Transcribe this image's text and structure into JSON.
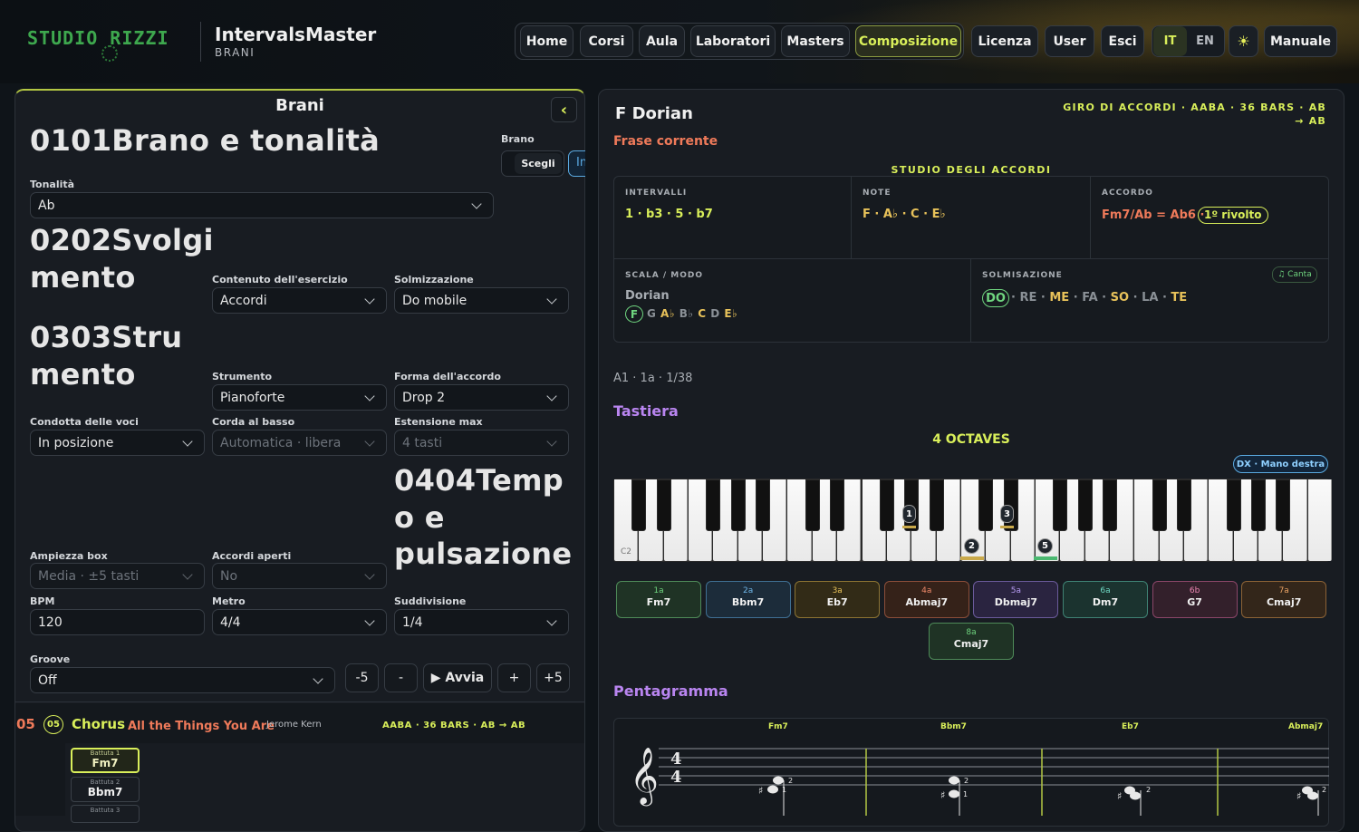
{
  "header": {
    "logo": "STUDIO RIZZI",
    "app_title": "IntervalsMaster",
    "app_section": "BRANI",
    "nav": [
      "Home",
      "Corsi",
      "Aula",
      "Laboratori",
      "Masters",
      "Composizione"
    ],
    "nav2": [
      "Licenza",
      "User",
      "Esci"
    ],
    "langs": [
      "IT",
      "EN"
    ],
    "theme_icon": "☀",
    "manual": "Manuale"
  },
  "left": {
    "title": "Brani",
    "collapse": "‹",
    "s1": "0101Brano e tonalità",
    "brano_label": "Brano",
    "scegli": "Scegli",
    "import_cut": "In",
    "tonalita_label": "Tonalità",
    "tonalita": "Ab",
    "s2a": "0202Svolgi",
    "s2b": "mento",
    "contenuto_label": "Contenuto dell'esercizio",
    "contenuto": "Accordi",
    "solm_label": "Solmizzazione",
    "solm": "Do mobile",
    "s3a": "0303Stru",
    "s3b": "mento",
    "strumento_label": "Strumento",
    "strumento": "Pianoforte",
    "forma_label": "Forma dell'accordo",
    "forma": "Drop 2",
    "condotta_label": "Condotta delle voci",
    "condotta": "In posizione",
    "corda_label": "Corda al basso",
    "corda": "Automatica · libera",
    "estensione_label": "Estensione max",
    "estensione": "4 tasti",
    "s4a": "0404Temp",
    "s4b": "o e",
    "s4c": "pulsazione",
    "ampiezza_label": "Ampiezza box",
    "ampiezza": "Media · ±5 tasti",
    "aperti_label": "Accordi aperti",
    "aperti": "No",
    "bpm_label": "BPM",
    "bpm": "120",
    "metro_label": "Metro",
    "metro": "4/4",
    "sudd_label": "Suddivisione",
    "sudd": "1/4",
    "groove_label": "Groove",
    "groove": "Off",
    "btn_m5": "-5",
    "btn_m": "-",
    "btn_start": "▶ Avvia",
    "btn_p": "+",
    "btn_p5": "+5",
    "sec5_num": "05",
    "sec5_badge": "05",
    "sec5_title": "Chorus",
    "song": "All the Things You Are",
    "composer": "Jerome Kern",
    "form": "AABA · 36 BARS · AB → AB",
    "bars": [
      {
        "label": "Battuta 1",
        "chord": "Fm7"
      },
      {
        "label": "Battuta 2",
        "chord": "Bbm7"
      },
      {
        "label": "Battuta 3",
        "chord": ""
      }
    ]
  },
  "right": {
    "mode": "F Dorian",
    "form_line1": "GIRO DI ACCORDI · AABA · 36 BARS · AB",
    "form_line2": "→ AB",
    "frase": "Frase corrente",
    "studio": "STUDIO DEGLI ACCORDI",
    "intervalli_label": "INTERVALLI",
    "intervalli": "1 · b3 · 5 · b7",
    "note_label": "NOTE",
    "note": "F · A♭ · C · E♭",
    "accordo_label": "ACCORDO",
    "accordo": "Fm7/Ab = Ab6 ·",
    "rivolto": "1º rivolto",
    "scala_label": "SCALA / MODO",
    "scala": "Dorian",
    "scala_root": "F",
    "scala_notes": "G A♭ B♭ C D E♭",
    "solm_label": "SOLMISAZIONE",
    "canta": "♫ Canta",
    "solm_syl": [
      "DO",
      "RE",
      "ME",
      "FA",
      "SO",
      "LA",
      "TE"
    ],
    "pos": "A1 · 1a · 1/38",
    "tastiera": "Tastiera",
    "octaves": "4 OCTAVES",
    "mano": "DX · Mano destra",
    "c2": "C2",
    "markers": [
      "1",
      "3",
      "2",
      "5"
    ],
    "chords": [
      {
        "ix": "1a",
        "name": "Fm7",
        "color": "#6fd57f",
        "bg": "#1f3325",
        "bd": "#4e8a58"
      },
      {
        "ix": "2a",
        "name": "Bbm7",
        "color": "#6fb6e8",
        "bg": "#1c2c3a",
        "bd": "#3f6f93"
      },
      {
        "ix": "3a",
        "name": "Eb7",
        "color": "#e8c25a",
        "bg": "#322b17",
        "bd": "#8d7433"
      },
      {
        "ix": "4a",
        "name": "Abmaj7",
        "color": "#ef8a6a",
        "bg": "#352219",
        "bd": "#8b4e3a"
      },
      {
        "ix": "5a",
        "name": "Dbmaj7",
        "color": "#b59af0",
        "bg": "#2a2440",
        "bd": "#6a5a9a"
      },
      {
        "ix": "6a",
        "name": "Dm7",
        "color": "#6fd8c4",
        "bg": "#1b332f",
        "bd": "#3f8274"
      },
      {
        "ix": "6b",
        "name": "G7",
        "color": "#ef86b4",
        "bg": "#33202b",
        "bd": "#8a4668"
      },
      {
        "ix": "7a",
        "name": "Cmaj7",
        "color": "#e9a264",
        "bg": "#33261a",
        "bd": "#8b6236"
      },
      {
        "ix": "8a",
        "name": "Cmaj7",
        "color": "#6fd57f",
        "bg": "#1f3325",
        "bd": "#4e8a58"
      }
    ],
    "pentagramma": "Pentagramma",
    "staff_chords": [
      "Fm7",
      "Bbm7",
      "Eb7",
      "Abmaj7"
    ],
    "time_sig": "4"
  }
}
